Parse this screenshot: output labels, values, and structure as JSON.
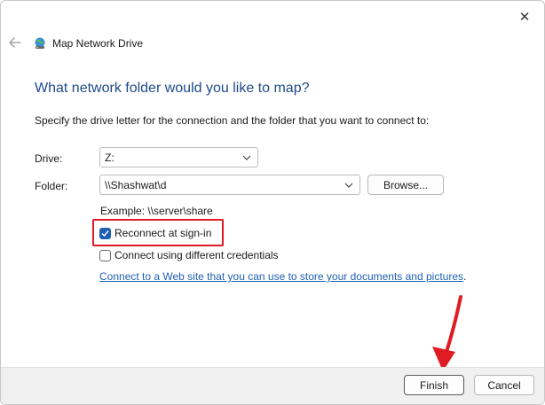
{
  "window": {
    "title": "Map Network Drive",
    "close_symbol": "✕",
    "back_icon": "back-arrow-icon"
  },
  "main": {
    "heading": "What network folder would you like to map?",
    "intro": "Specify the drive letter for the connection and the folder that you want to connect to:",
    "drive_label": "Drive:",
    "drive_value": "Z:",
    "folder_label": "Folder:",
    "folder_value": "\\\\Shashwat\\d",
    "browse_label": "Browse...",
    "example": "Example: \\\\server\\share",
    "reconnect_label": "Reconnect at sign-in",
    "reconnect_checked": true,
    "credentials_label": "Connect using different credentials",
    "credentials_checked": false,
    "web_link": "Connect to a Web site that you can use to store your documents and pictures",
    "web_link_suffix": "."
  },
  "footer": {
    "finish_label": "Finish",
    "cancel_label": "Cancel"
  },
  "colors": {
    "heading": "#1f4a8a",
    "link": "#1f5fb4",
    "checkbox": "#1f5fb4",
    "highlight": "#e01b24"
  }
}
